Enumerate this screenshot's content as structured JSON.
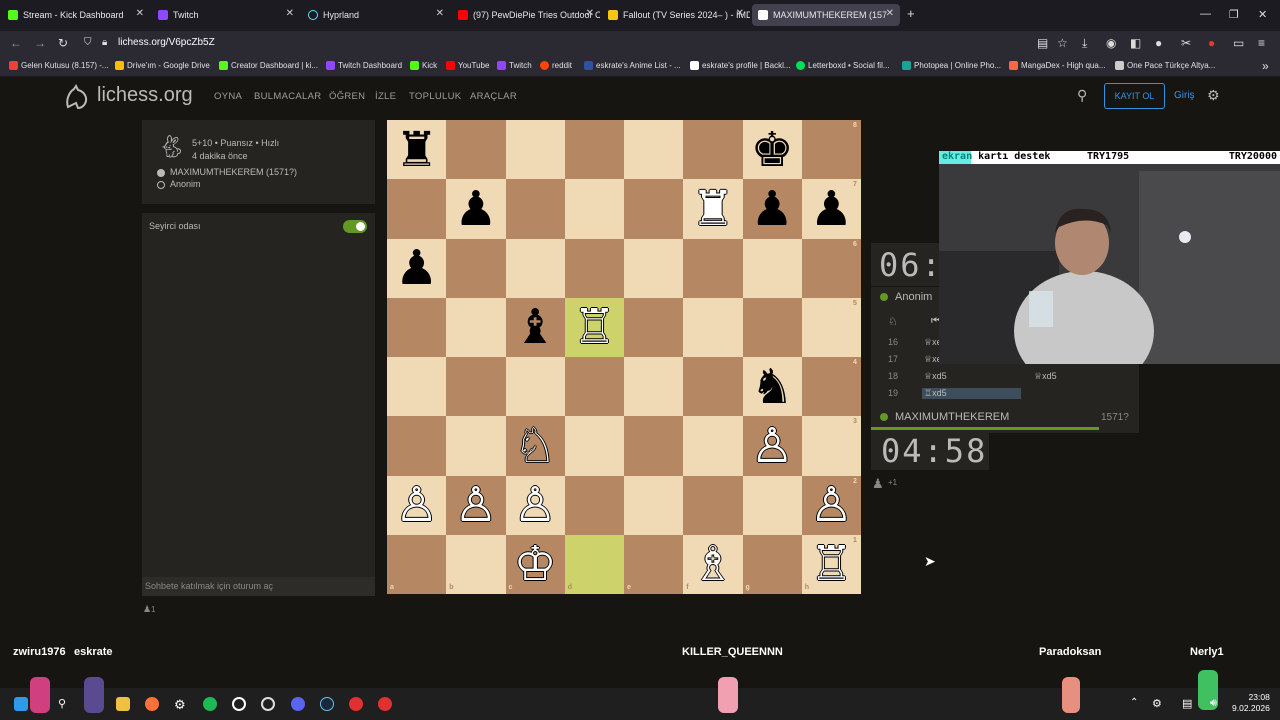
{
  "browser": {
    "tabs": [
      {
        "title": "Stream - Kick Dashboard",
        "color": "#53fc18"
      },
      {
        "title": "Twitch",
        "color": "#9146ff"
      },
      {
        "title": "Hyprland",
        "color": "#58e1ff"
      },
      {
        "title": "(97) PewDiePie Tries Outdoor C",
        "color": "#ff0000"
      },
      {
        "title": "Fallout (TV Series 2024– ) - IMD",
        "color": "#f5c518"
      },
      {
        "title": "MAXIMUMTHEKEREM (157",
        "color": "#ffffff"
      }
    ],
    "new_tab": "+",
    "url": "lichess.org/V6pcZb5Z",
    "bookmarks": [
      {
        "label": "Gelen Kutusu (8.157) -...",
        "color": "#ea4335"
      },
      {
        "label": "Drive'ım - Google Drive",
        "color": "#fbbc04"
      },
      {
        "label": "Creator Dashboard | ki...",
        "color": "#53fc18"
      },
      {
        "label": "Twitch Dashboard",
        "color": "#9146ff"
      },
      {
        "label": "Kick",
        "color": "#53fc18"
      },
      {
        "label": "YouTube",
        "color": "#ff0000"
      },
      {
        "label": "Twitch",
        "color": "#9146ff"
      },
      {
        "label": "reddit",
        "color": "#ff4500"
      },
      {
        "label": "eskrate's Anime List - ...",
        "color": "#2e51a2"
      },
      {
        "label": "eskrate's profile | Backl...",
        "color": "#ffffff"
      },
      {
        "label": "Letterboxd • Social fil...",
        "color": "#00e054"
      },
      {
        "label": "Photopea | Online Pho...",
        "color": "#18a497"
      },
      {
        "label": "MangaDex - High qua...",
        "color": "#ff6740"
      },
      {
        "label": "One Pace Türkçe Altya...",
        "color": "#cccccc"
      }
    ]
  },
  "lichess": {
    "logo": "lichess.org",
    "nav": [
      "OYNA",
      "BULMACALAR",
      "ÖĞREN",
      "İZLE",
      "TOPLULUK",
      "ARAÇLAR"
    ],
    "signup": "KAYIT OL",
    "login": "Giriş",
    "game_info": {
      "mode": "5+10 • Puansız • Hızlı",
      "time_ago": "4 dakika önce",
      "white_player": "MAXIMUMTHEKEREM (1571?)",
      "black_player": "Anonim"
    },
    "chat": {
      "room": "Seyirci odası",
      "placeholder": "Sohbete katılmak için oturum aç",
      "spectators": "1"
    },
    "board": {
      "files": [
        "a",
        "b",
        "c",
        "d",
        "e",
        "f",
        "g",
        "h"
      ],
      "ranks": [
        "8",
        "7",
        "6",
        "5",
        "4",
        "3",
        "2",
        "1"
      ],
      "pieces": [
        {
          "sq": "a8",
          "p": "♜",
          "c": "b"
        },
        {
          "sq": "g8",
          "p": "♚",
          "c": "b"
        },
        {
          "sq": "b7",
          "p": "♟",
          "c": "b"
        },
        {
          "sq": "f7",
          "p": "♜",
          "c": "w"
        },
        {
          "sq": "g7",
          "p": "♟",
          "c": "b"
        },
        {
          "sq": "h7",
          "p": "♟",
          "c": "b"
        },
        {
          "sq": "a6",
          "p": "♟",
          "c": "b"
        },
        {
          "sq": "c5",
          "p": "♝",
          "c": "b"
        },
        {
          "sq": "d5",
          "p": "♖",
          "c": "w"
        },
        {
          "sq": "g4",
          "p": "♞",
          "c": "b"
        },
        {
          "sq": "c3",
          "p": "♘",
          "c": "w"
        },
        {
          "sq": "g3",
          "p": "♙",
          "c": "w"
        },
        {
          "sq": "a2",
          "p": "♙",
          "c": "w"
        },
        {
          "sq": "b2",
          "p": "♙",
          "c": "w"
        },
        {
          "sq": "c2",
          "p": "♙",
          "c": "w"
        },
        {
          "sq": "h2",
          "p": "♙",
          "c": "w"
        },
        {
          "sq": "c1",
          "p": "♔",
          "c": "w"
        },
        {
          "sq": "f1",
          "p": "♗",
          "c": "w"
        },
        {
          "sq": "h1",
          "p": "♖",
          "c": "w"
        }
      ],
      "highlights": [
        "d5",
        "d1"
      ]
    },
    "top_clock": "06:",
    "top_player": "Anonim",
    "moves": [
      {
        "n": "16",
        "w": "♕xe",
        "b": ""
      },
      {
        "n": "17",
        "w": "♕xe",
        "b": ""
      },
      {
        "n": "18",
        "w": "♕xd5",
        "b": "♕xd5"
      },
      {
        "n": "19",
        "w": "♖xd5",
        "b": ""
      }
    ],
    "bottom_player": "MAXIMUMTHEKEREM",
    "bottom_rating": "1571?",
    "bottom_clock": "04:58",
    "material": "+1"
  },
  "stream": {
    "ticker_left": "ekran kartı destek",
    "ticker_mid": "TRY1795",
    "ticker_right": "TRY20000",
    "names": [
      "zwiru1976",
      "eskrate",
      "KILLER_QUEENNN",
      "Paradoksan",
      "Nerly1"
    ]
  },
  "taskbar": {
    "time": "23:08",
    "date": "9.02.2026"
  }
}
